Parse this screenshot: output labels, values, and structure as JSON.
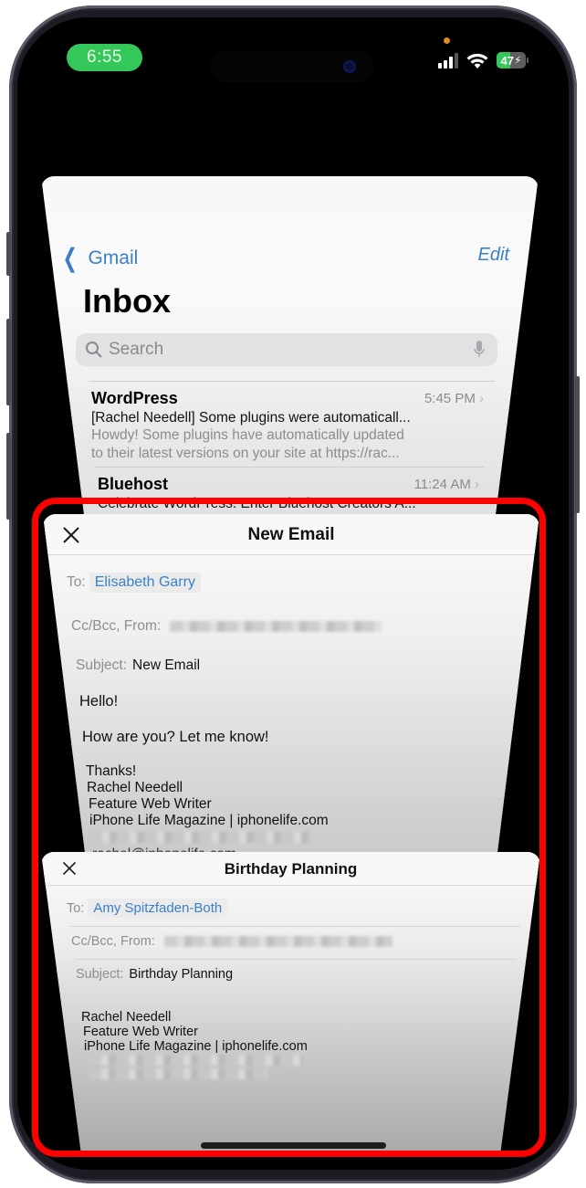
{
  "status_bar": {
    "time": "6:55",
    "battery_percent": 47,
    "battery_label": "47",
    "charging": true,
    "signal_bars_active": 3,
    "signal_bars_total": 4,
    "colors": {
      "time_pill": "#34c759",
      "privacy_dot": "#e08a2e"
    }
  },
  "app_switcher": {
    "cards": [
      {
        "type": "inbox",
        "back_label": "Gmail",
        "edit_label": "Edit",
        "title": "Inbox",
        "search_placeholder": "Search",
        "messages": [
          {
            "sender": "WordPress",
            "time": "5:45 PM",
            "subject": "[Rachel Needell] Some plugins were automaticall...",
            "preview_line1": "Howdy! Some plugins have automatically updated",
            "preview_line2": "to their latest versions on your site at https://rac..."
          },
          {
            "sender": "Bluehost",
            "time": "11:24 AM",
            "subject": "Celebrate WordPress: Enter Bluehost Creators A..."
          }
        ]
      },
      {
        "type": "compose",
        "title": "New Email",
        "to_label": "To:",
        "to_value": "Elisabeth Garry",
        "ccbcc_label": "Cc/Bcc, From:",
        "subject_label": "Subject:",
        "subject_value": "New Email",
        "body": [
          "Hello!",
          "How are you? Let me know!",
          "Thanks!",
          "Rachel Needell",
          "Feature Web Writer",
          "iPhone Life Magazine | iphonelife.com",
          "rachel@iphonelife.com"
        ]
      },
      {
        "type": "compose",
        "title": "Birthday Planning",
        "to_label": "To:",
        "to_value": "Amy Spitzfaden-Both",
        "ccbcc_label": "Cc/Bcc, From:",
        "subject_label": "Subject:",
        "subject_value": "Birthday Planning",
        "body": [
          "Rachel Needell",
          "Feature Web Writer",
          "iPhone Life Magazine | iphonelife.com"
        ]
      }
    ]
  },
  "annotation": {
    "highlight_color": "#ff0000"
  },
  "accent_color": "#3a80c9"
}
